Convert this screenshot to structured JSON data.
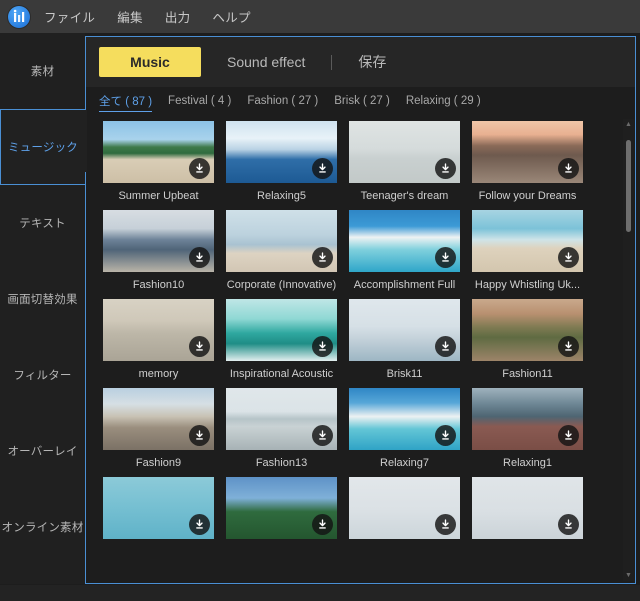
{
  "app": {
    "logo_icon": "equalizer-logo-icon",
    "accent_blue": "#4a8fd4",
    "accent_yellow": "#f5dd5d",
    "background": "#1d1d1d"
  },
  "menubar": {
    "items": [
      {
        "label": "ファイル",
        "name": "menu-file"
      },
      {
        "label": "編集",
        "name": "menu-edit"
      },
      {
        "label": "出力",
        "name": "menu-export"
      },
      {
        "label": "ヘルプ",
        "name": "menu-help"
      }
    ]
  },
  "sidebar": {
    "items": [
      {
        "label": "素材",
        "active": false
      },
      {
        "label": "ミュージック",
        "active": true
      },
      {
        "label": "テキスト",
        "active": false
      },
      {
        "label": "画面切替効果",
        "active": false
      },
      {
        "label": "フィルター",
        "active": false
      },
      {
        "label": "オーバーレイ",
        "active": false
      },
      {
        "label": "オンライン素材",
        "active": false
      }
    ]
  },
  "tabs": [
    {
      "label": "Music",
      "active": true
    },
    {
      "label": "Sound effect",
      "active": false
    },
    {
      "label": "保存",
      "active": false
    }
  ],
  "filters": [
    {
      "label": "全て ( 87 )",
      "active": true
    },
    {
      "label": "Festival ( 4 )",
      "active": false
    },
    {
      "label": "Fashion ( 27 )",
      "active": false
    },
    {
      "label": "Brisk ( 27 )",
      "active": false
    },
    {
      "label": "Relaxing ( 29 )",
      "active": false
    }
  ],
  "grid": {
    "download_icon": "download-icon",
    "items": [
      {
        "title": "Summer Upbeat",
        "scene": "beach-palms"
      },
      {
        "title": "Relaxing5",
        "scene": "iceberg"
      },
      {
        "title": "Teenager's dream",
        "scene": "person-back"
      },
      {
        "title": "Follow your Dreams",
        "scene": "sunset-shore"
      },
      {
        "title": "Fashion10",
        "scene": "mountains"
      },
      {
        "title": "Corporate (Innovative)",
        "scene": "red-dress-beach"
      },
      {
        "title": "Accomplishment Full",
        "scene": "white-sand-bay"
      },
      {
        "title": "Happy Whistling Uk...",
        "scene": "beach-walkers"
      },
      {
        "title": "memory",
        "scene": "sneakers"
      },
      {
        "title": "Inspirational Acoustic",
        "scene": "surfer"
      },
      {
        "title": "Brisk11",
        "scene": "foggy-shore"
      },
      {
        "title": "Fashion11",
        "scene": "town-church"
      },
      {
        "title": "Fashion9",
        "scene": "airplane-wing"
      },
      {
        "title": "Fashion13",
        "scene": "calm-sea"
      },
      {
        "title": "Relaxing7",
        "scene": "turquoise-bay"
      },
      {
        "title": "Relaxing1",
        "scene": "hiker-lake"
      },
      {
        "title": "",
        "scene": "teal-water"
      },
      {
        "title": "",
        "scene": "tropical-trees"
      },
      {
        "title": "",
        "scene": "pale-sky"
      },
      {
        "title": "",
        "scene": "pale-crane"
      }
    ]
  },
  "scrollbar": {
    "up_icon": "caret-up-icon",
    "down_icon": "caret-down-icon"
  }
}
